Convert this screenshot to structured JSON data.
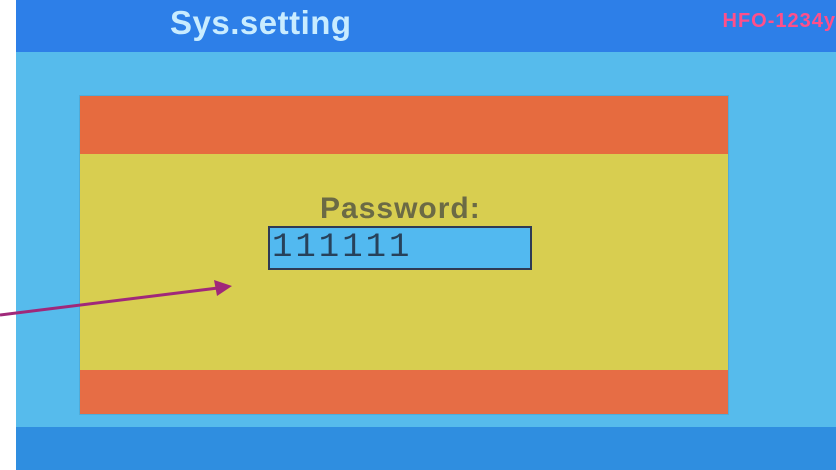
{
  "screen": {
    "title": "Sys.setting",
    "refrigerant_label": "HFO-1234y"
  },
  "dialog": {
    "password_label": "Password:",
    "password_value": "111111"
  },
  "colors": {
    "title_bar": "#2d7fe8",
    "background": "#56bbec",
    "dialog_header": "#e66b3f",
    "dialog_body": "#d8ce50",
    "annotation_arrow": "#a0287a"
  }
}
